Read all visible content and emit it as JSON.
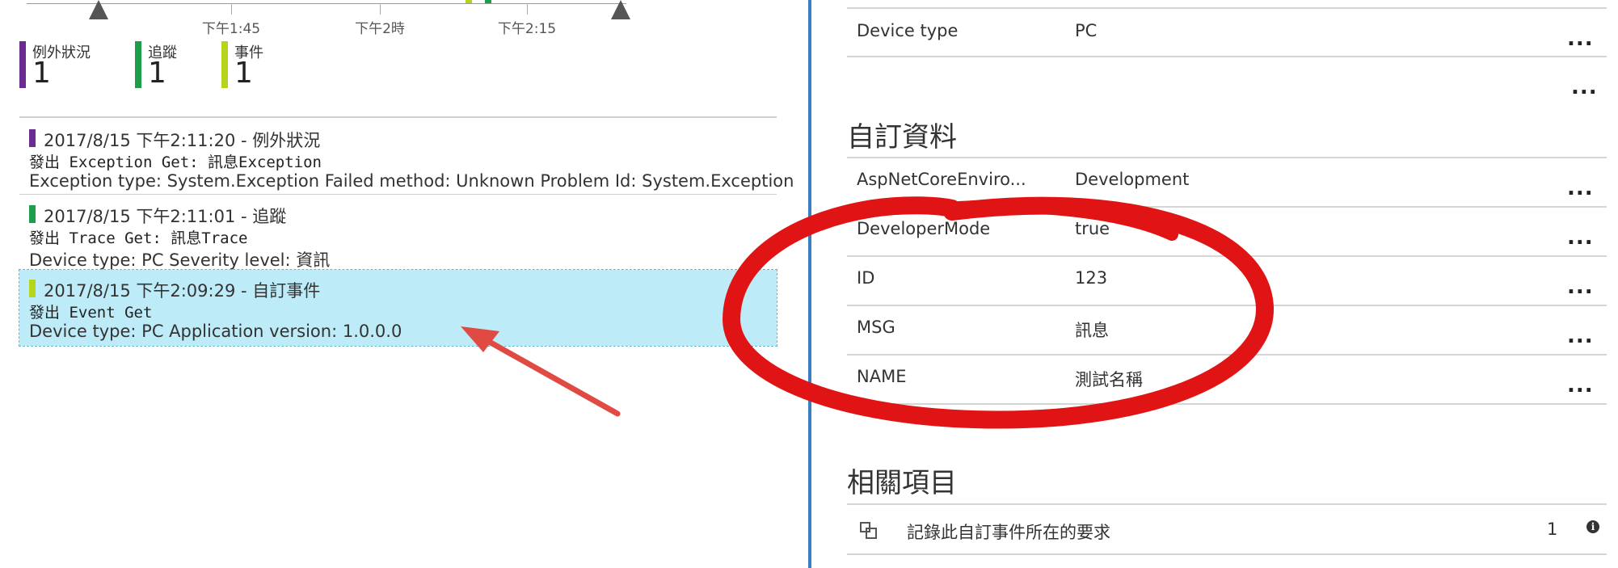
{
  "timeline": {
    "ticks": [
      "下午1:45",
      "下午2時",
      "下午2:15"
    ]
  },
  "legend": [
    {
      "label": "例外狀況",
      "count": "1",
      "color": "#6b2c91"
    },
    {
      "label": "追蹤",
      "count": "1",
      "color": "#1e9e4a"
    },
    {
      "label": "事件",
      "count": "1",
      "color": "#b5d41c"
    }
  ],
  "events": [
    {
      "header": "2017/8/15 下午2:11:20 - 例外狀況",
      "prefix": "發出",
      "op": " Exception Get: 訊息Exception",
      "details": "Exception type: System.Exception  Failed method: Unknown  Problem Id: System.Exception",
      "color": "#6b2c91"
    },
    {
      "header": "2017/8/15 下午2:11:01 - 追蹤",
      "prefix": "發出",
      "op": " Trace Get: 訊息Trace",
      "details": "Device type: PC  Severity level: 資訊",
      "color": "#1e9e4a"
    },
    {
      "header": "2017/8/15 下午2:09:29 - 自訂事件",
      "prefix": "發出",
      "op": " Event Get",
      "details": "Device type: PC  Application version: 1.0.0.0",
      "color": "#b5d41c"
    }
  ],
  "properties": {
    "device_type": {
      "key": "Device type",
      "value": "PC"
    },
    "more": "...",
    "custom_title": "自訂資料",
    "custom": [
      {
        "key": "AspNetCoreEnviro...",
        "value": "Development"
      },
      {
        "key": "DeveloperMode",
        "value": "true"
      },
      {
        "key": "ID",
        "value": "123"
      },
      {
        "key": "MSG",
        "value": "訊息"
      },
      {
        "key": "NAME",
        "value": "測試名稱"
      }
    ],
    "related_title": "相關項目",
    "related": {
      "label": "記錄此自訂事件所在的要求",
      "count": "1",
      "info": "i"
    }
  },
  "colors": {
    "annotation_red": "#e01414",
    "arrow_red": "#e04a43",
    "selection_bg": "#bdebf7",
    "splitter": "#3a7fc4"
  }
}
